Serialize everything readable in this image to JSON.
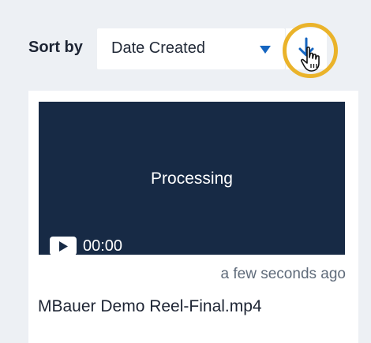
{
  "sort": {
    "label": "Sort by",
    "selected": "Date Created",
    "caret_icon": "caret-down-icon",
    "direction_icon": "arrow-down-icon"
  },
  "video": {
    "status": "Processing",
    "duration": "00:00",
    "timestamp": "a few seconds ago",
    "file_name": "MBauer Demo Reel-Final.mp4",
    "play_icon": "play-icon"
  },
  "colors": {
    "background": "#edf0f4",
    "thumbnail": "#172a45",
    "accent": "#1565c0",
    "highlight": "#eab32a"
  }
}
